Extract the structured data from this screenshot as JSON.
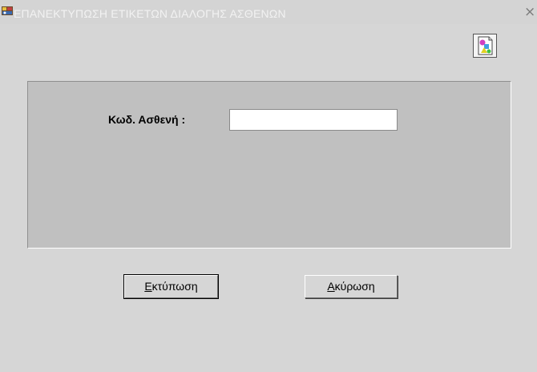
{
  "window": {
    "title": "ΕΠΑΝΕΚΤΥΠΩΣΗ ΕΤΙΚΕΤΩΝ ΔΙΑΛΟΓΗΣ ΑΣΘΕΝΩΝ",
    "close_glyph": "×"
  },
  "form": {
    "patient_code_label": "Κωδ. Ασθενή :",
    "patient_code_value": ""
  },
  "buttons": {
    "print": {
      "mnemonic": "Ε",
      "rest": "κτύπωση"
    },
    "cancel": {
      "mnemonic": "Α",
      "rest": "κύρωση"
    }
  },
  "icons": {
    "app": "oracle-forms-app-icon",
    "toolbar": "shapes-document-icon"
  }
}
